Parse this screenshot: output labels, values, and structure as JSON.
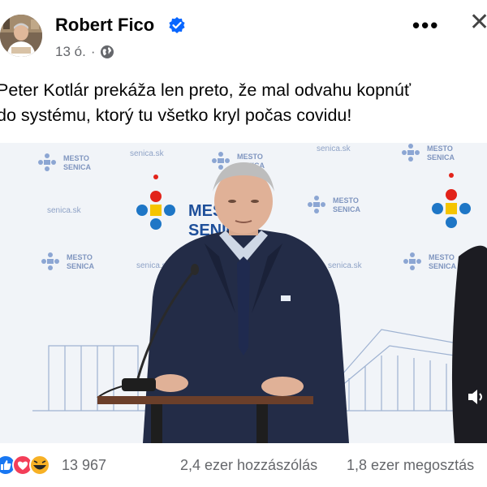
{
  "post": {
    "author": "Robert Fico",
    "time": "13 ó.",
    "dot": "·",
    "text_line1": "Peter Kotlár prekáža len preto, že mal odvahu kopnúť",
    "text_line2": "do systému, ktorý tu všetko kryl počas covidu!"
  },
  "header_icons": {
    "more": "•••",
    "close": "✕"
  },
  "video": {
    "backdrop_brand_line1": "MESTO",
    "backdrop_brand_line2": "SENICA",
    "backdrop_url": "senica.sk"
  },
  "footer": {
    "reaction_count": "13 967",
    "comments": "2,4 ezer hozzászólás",
    "shares": "1,8 ezer megosztás"
  },
  "colors": {
    "verified_blue": "#0866ff",
    "logo_red": "#e2231a",
    "logo_blue": "#1e76c6",
    "logo_yellow": "#f5c400"
  }
}
